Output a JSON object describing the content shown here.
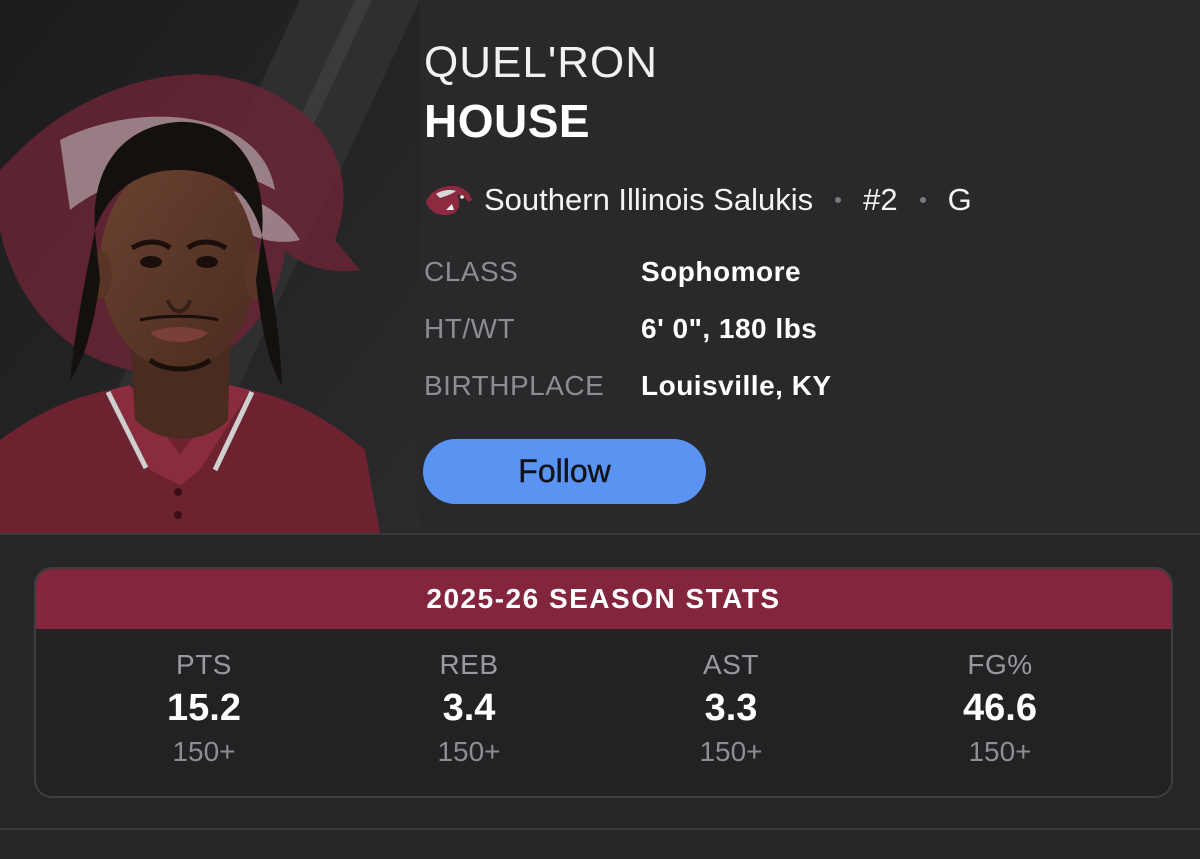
{
  "player": {
    "first_name": "QUEL'RON",
    "last_name": "HOUSE",
    "team": "Southern Illinois Salukis",
    "number": "#2",
    "position": "G",
    "photo_alt": "player headshot",
    "logo_alt": "salukis logo"
  },
  "info": [
    {
      "label": "CLASS",
      "value": "Sophomore"
    },
    {
      "label": "HT/WT",
      "value": "6' 0\", 180 lbs"
    },
    {
      "label": "BIRTHPLACE",
      "value": "Louisville, KY"
    }
  ],
  "follow_label": "Follow",
  "season_stats": {
    "title": "2025-26 SEASON STATS",
    "stats": [
      {
        "label": "PTS",
        "value": "15.2",
        "rank": "150+"
      },
      {
        "label": "REB",
        "value": "3.4",
        "rank": "150+"
      },
      {
        "label": "AST",
        "value": "3.3",
        "rank": "150+"
      },
      {
        "label": "FG%",
        "value": "46.6",
        "rank": "150+"
      }
    ]
  },
  "colors": {
    "accent_maroon": "#84253e",
    "follow_blue": "#5b93f3",
    "background": "#262628"
  }
}
